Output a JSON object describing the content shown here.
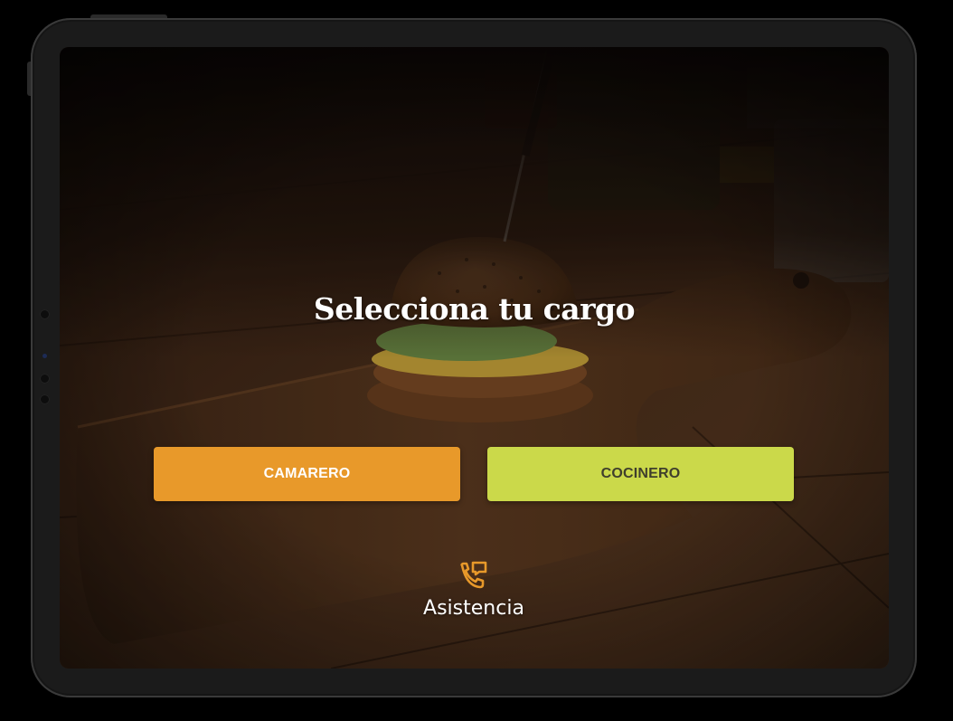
{
  "screen": {
    "title": "Selecciona tu cargo"
  },
  "roles": {
    "waiter_label": "CAMARERO",
    "cook_label": "COCINERO"
  },
  "support": {
    "label": "Asistencia",
    "icon": "phone-support-icon"
  },
  "colors": {
    "waiter_button": "#e8992a",
    "cook_button": "#cbd94a",
    "accent_icon": "#e8992a"
  }
}
